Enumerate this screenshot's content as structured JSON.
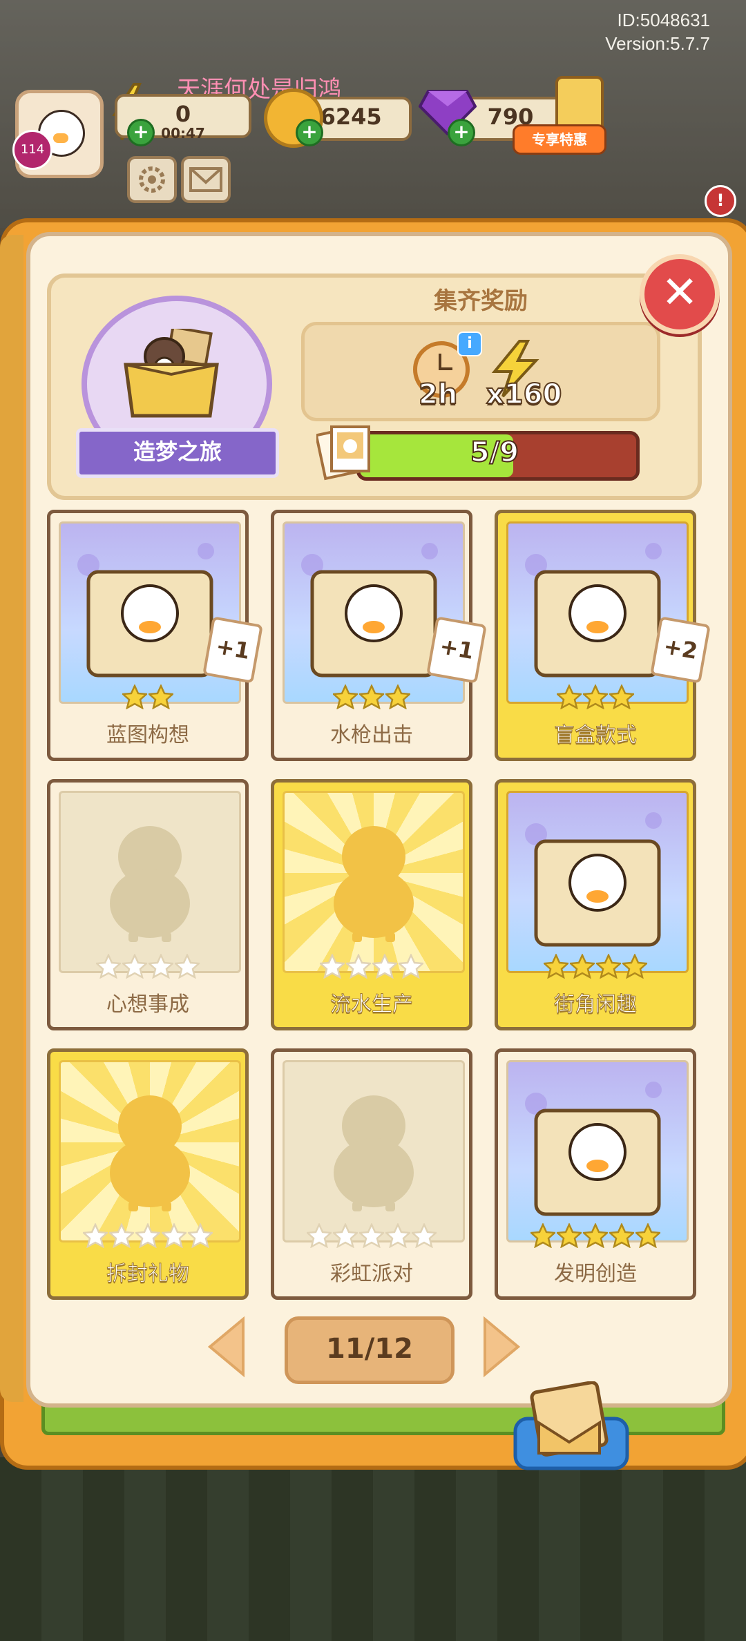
{
  "hud": {
    "id_line": "ID:5048631",
    "version_line": "Version:5.7.7",
    "player_name": "天涯何处是归鸿",
    "level": "114",
    "energy": "0",
    "energy_timer": "00:47",
    "coins": "26245",
    "gems": "790",
    "deal_tag": "专享特惠"
  },
  "album": {
    "header_title": "集齐奖励",
    "album_name": "造梦之旅",
    "reward_time": "2h",
    "reward_energy": "x160",
    "progress_text": "5/9",
    "progress_fraction": 0.555
  },
  "cards": [
    {
      "name": "蓝图构想",
      "stars": 2,
      "style": "cream",
      "collected": true,
      "badge": "+1"
    },
    {
      "name": "水枪出击",
      "stars": 3,
      "style": "cream",
      "collected": true,
      "badge": "+1"
    },
    {
      "name": "盲盒款式",
      "stars": 3,
      "style": "gold",
      "collected": true,
      "badge": "+2"
    },
    {
      "name": "心想事成",
      "stars": 4,
      "style": "cream",
      "collected": false,
      "badge": ""
    },
    {
      "name": "流水生产",
      "stars": 4,
      "style": "gold",
      "collected": false,
      "badge": ""
    },
    {
      "name": "街角闲趣",
      "stars": 4,
      "style": "gold",
      "collected": true,
      "badge": ""
    },
    {
      "name": "拆封礼物",
      "stars": 5,
      "style": "gold",
      "collected": false,
      "badge": ""
    },
    {
      "name": "彩虹派对",
      "stars": 5,
      "style": "cream",
      "collected": false,
      "badge": ""
    },
    {
      "name": "发明创造",
      "stars": 5,
      "style": "cream",
      "collected": true,
      "badge": ""
    }
  ],
  "pagination": {
    "page_label": "11/12"
  },
  "colors": {
    "accent_gold": "#f9dc47",
    "frame_orange": "#f2a334",
    "progress_green": "#a6e63c",
    "progress_track": "#a8402f",
    "close_red": "#e24b4b"
  }
}
